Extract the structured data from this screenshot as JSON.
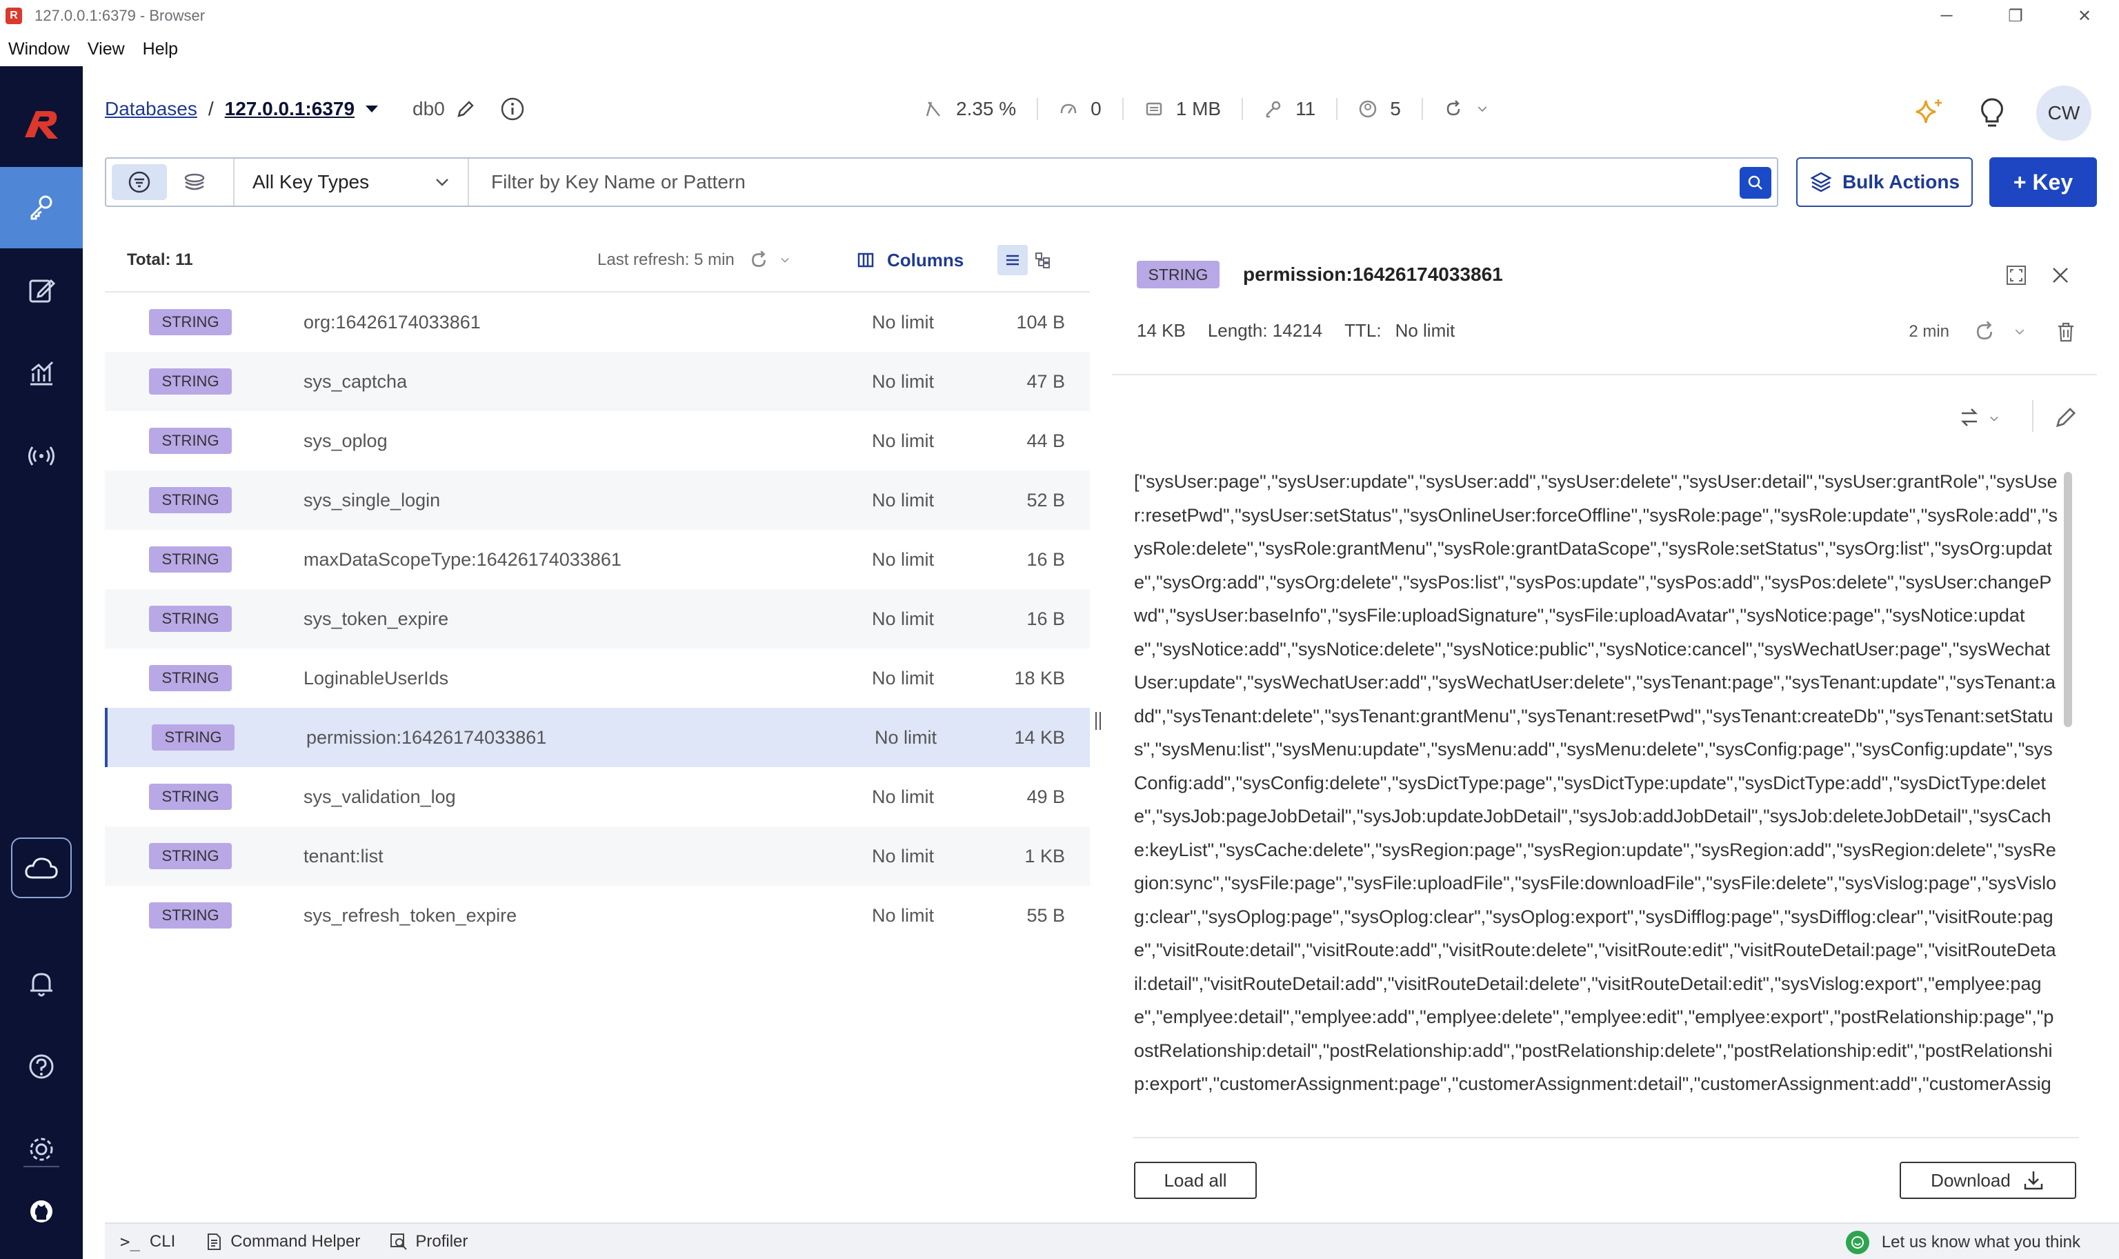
{
  "window": {
    "title": "127.0.0.1:6379 - Browser",
    "controls": [
      "─",
      "❐",
      "✕"
    ]
  },
  "menu": [
    "Window",
    "View",
    "Help"
  ],
  "header": {
    "breadcrumb_link": "Databases",
    "separator": "/",
    "host": "127.0.0.1:6379",
    "db": "db0",
    "stats": {
      "cpu": "2.35 %",
      "ops": "0",
      "memory": "1 MB",
      "keys": "11",
      "clients": "5"
    },
    "avatar": "CW"
  },
  "filter": {
    "key_type": "All Key Types",
    "placeholder": "Filter by Key Name or Pattern",
    "bulk_actions": "Bulk Actions",
    "add_key": "+ Key"
  },
  "list": {
    "total": "Total: 11",
    "last_refresh": "Last refresh: 5 min",
    "columns_label": "Columns",
    "rows": [
      {
        "type": "STRING",
        "name": "org:16426174033861",
        "ttl": "No limit",
        "size": "104 B"
      },
      {
        "type": "STRING",
        "name": "sys_captcha",
        "ttl": "No limit",
        "size": "47 B"
      },
      {
        "type": "STRING",
        "name": "sys_oplog",
        "ttl": "No limit",
        "size": "44 B"
      },
      {
        "type": "STRING",
        "name": "sys_single_login",
        "ttl": "No limit",
        "size": "52 B"
      },
      {
        "type": "STRING",
        "name": "maxDataScopeType:16426174033861",
        "ttl": "No limit",
        "size": "16 B"
      },
      {
        "type": "STRING",
        "name": "sys_token_expire",
        "ttl": "No limit",
        "size": "16 B"
      },
      {
        "type": "STRING",
        "name": "LoginableUserIds",
        "ttl": "No limit",
        "size": "18 KB"
      },
      {
        "type": "STRING",
        "name": "permission:16426174033861",
        "ttl": "No limit",
        "size": "14 KB"
      },
      {
        "type": "STRING",
        "name": "sys_validation_log",
        "ttl": "No limit",
        "size": "49 B"
      },
      {
        "type": "STRING",
        "name": "tenant:list",
        "ttl": "No limit",
        "size": "1 KB"
      },
      {
        "type": "STRING",
        "name": "sys_refresh_token_expire",
        "ttl": "No limit",
        "size": "55 B"
      }
    ]
  },
  "detail": {
    "type": "STRING",
    "key": "permission:16426174033861",
    "size": "14 KB",
    "length": "Length: 14214",
    "ttl_label": "TTL:",
    "ttl_value": "No limit",
    "refresh_age": "2 min",
    "value": "[\"sysUser:page\",\"sysUser:update\",\"sysUser:add\",\"sysUser:delete\",\"sysUser:detail\",\"sysUser:grantRole\",\"sysUser:resetPwd\",\"sysUser:setStatus\",\"sysOnlineUser:forceOffline\",\"sysRole:page\",\"sysRole:update\",\"sysRole:add\",\"sysRole:delete\",\"sysRole:grantMenu\",\"sysRole:grantDataScope\",\"sysRole:setStatus\",\"sysOrg:list\",\"sysOrg:update\",\"sysOrg:add\",\"sysOrg:delete\",\"sysPos:list\",\"sysPos:update\",\"sysPos:add\",\"sysPos:delete\",\"sysUser:changePwd\",\"sysUser:baseInfo\",\"sysFile:uploadSignature\",\"sysFile:uploadAvatar\",\"sysNotice:page\",\"sysNotice:update\",\"sysNotice:add\",\"sysNotice:delete\",\"sysNotice:public\",\"sysNotice:cancel\",\"sysWechatUser:page\",\"sysWechatUser:update\",\"sysWechatUser:add\",\"sysWechatUser:delete\",\"sysTenant:page\",\"sysTenant:update\",\"sysTenant:add\",\"sysTenant:delete\",\"sysTenant:grantMenu\",\"sysTenant:resetPwd\",\"sysTenant:createDb\",\"sysTenant:setStatus\",\"sysMenu:list\",\"sysMenu:update\",\"sysMenu:add\",\"sysMenu:delete\",\"sysConfig:page\",\"sysConfig:update\",\"sysConfig:add\",\"sysConfig:delete\",\"sysDictType:page\",\"sysDictType:update\",\"sysDictType:add\",\"sysDictType:delete\",\"sysJob:pageJobDetail\",\"sysJob:updateJobDetail\",\"sysJob:addJobDetail\",\"sysJob:deleteJobDetail\",\"sysCache:keyList\",\"sysCache:delete\",\"sysRegion:page\",\"sysRegion:update\",\"sysRegion:add\",\"sysRegion:delete\",\"sysRegion:sync\",\"sysFile:page\",\"sysFile:uploadFile\",\"sysFile:downloadFile\",\"sysFile:delete\",\"sysVislog:page\",\"sysVislog:clear\",\"sysOplog:page\",\"sysOplog:clear\",\"sysOplog:export\",\"sysDifflog:page\",\"sysDifflog:clear\",\"visitRoute:page\",\"visitRoute:detail\",\"visitRoute:add\",\"visitRoute:delete\",\"visitRoute:edit\",\"visitRouteDetail:page\",\"visitRouteDetail:detail\",\"visitRouteDetail:add\",\"visitRouteDetail:delete\",\"visitRouteDetail:edit\",\"sysVislog:export\",\"emplyee:page\",\"emplyee:detail\",\"emplyee:add\",\"emplyee:delete\",\"emplyee:edit\",\"emplyee:export\",\"postRelationship:page\",\"postRelationship:detail\",\"postRelationship:add\",\"postRelationship:delete\",\"postRelationship:edit\",\"postRelationship:export\",\"customerAssignment:page\",\"customerAssignment:detail\",\"customerAssignment:add\",\"customerAssignment:delete\",\"customerAssignment:edit\",\"customerAssignment:export\"",
    "load_all": "Load all",
    "download": "Download"
  },
  "bottom": {
    "cli": "CLI",
    "cli_prefix": ">_",
    "helper": "Command Helper",
    "profiler": "Profiler",
    "feedback": "Let us know what you think"
  },
  "colors": {
    "nav_bg": "#0b1233",
    "nav_active": "#4f86d6",
    "accent": "#1e46c2",
    "badge": "#b9a8e6",
    "logo": "#dc382c"
  }
}
